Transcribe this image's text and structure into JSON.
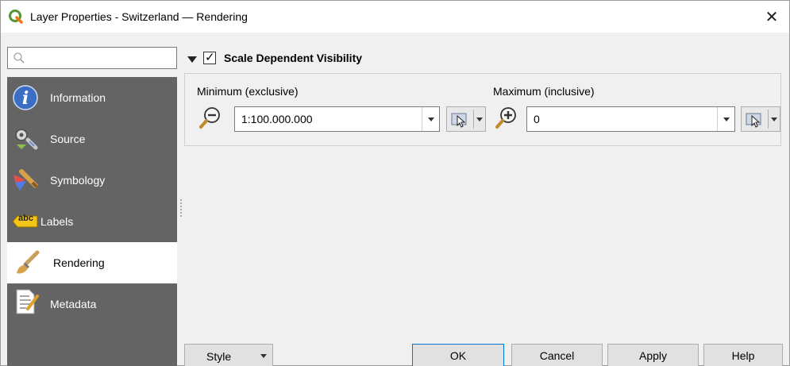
{
  "window": {
    "title": "Layer Properties - Switzerland — Rendering",
    "close_glyph": "✕"
  },
  "search": {
    "placeholder": "",
    "value": ""
  },
  "sidebar": {
    "items": [
      {
        "label": "Information",
        "icon": "information-icon",
        "active": false
      },
      {
        "label": "Source",
        "icon": "source-icon",
        "active": false
      },
      {
        "label": "Symbology",
        "icon": "symbology-icon",
        "active": false
      },
      {
        "label": "Labels",
        "icon": "labels-icon",
        "active": false
      },
      {
        "label": "Rendering",
        "icon": "rendering-icon",
        "active": true
      },
      {
        "label": "Metadata",
        "icon": "metadata-icon",
        "active": false
      }
    ],
    "labels_badge": "abc"
  },
  "scale_visibility": {
    "title": "Scale Dependent Visibility",
    "checked": true,
    "expanded": true,
    "minimum": {
      "label": "Minimum (exclusive)",
      "value": "1:100.000.000"
    },
    "maximum": {
      "label": "Maximum (inclusive)",
      "value": "0"
    }
  },
  "buttons": {
    "style": "Style",
    "ok": "OK",
    "cancel": "Cancel",
    "apply": "Apply",
    "help": "Help"
  },
  "colors": {
    "sidebar_bg": "#646464",
    "active_item_bg": "#ffffff",
    "qgis_green": "#589632",
    "info_blue": "#3a6fc4",
    "default_button_border": "#0078d7"
  }
}
